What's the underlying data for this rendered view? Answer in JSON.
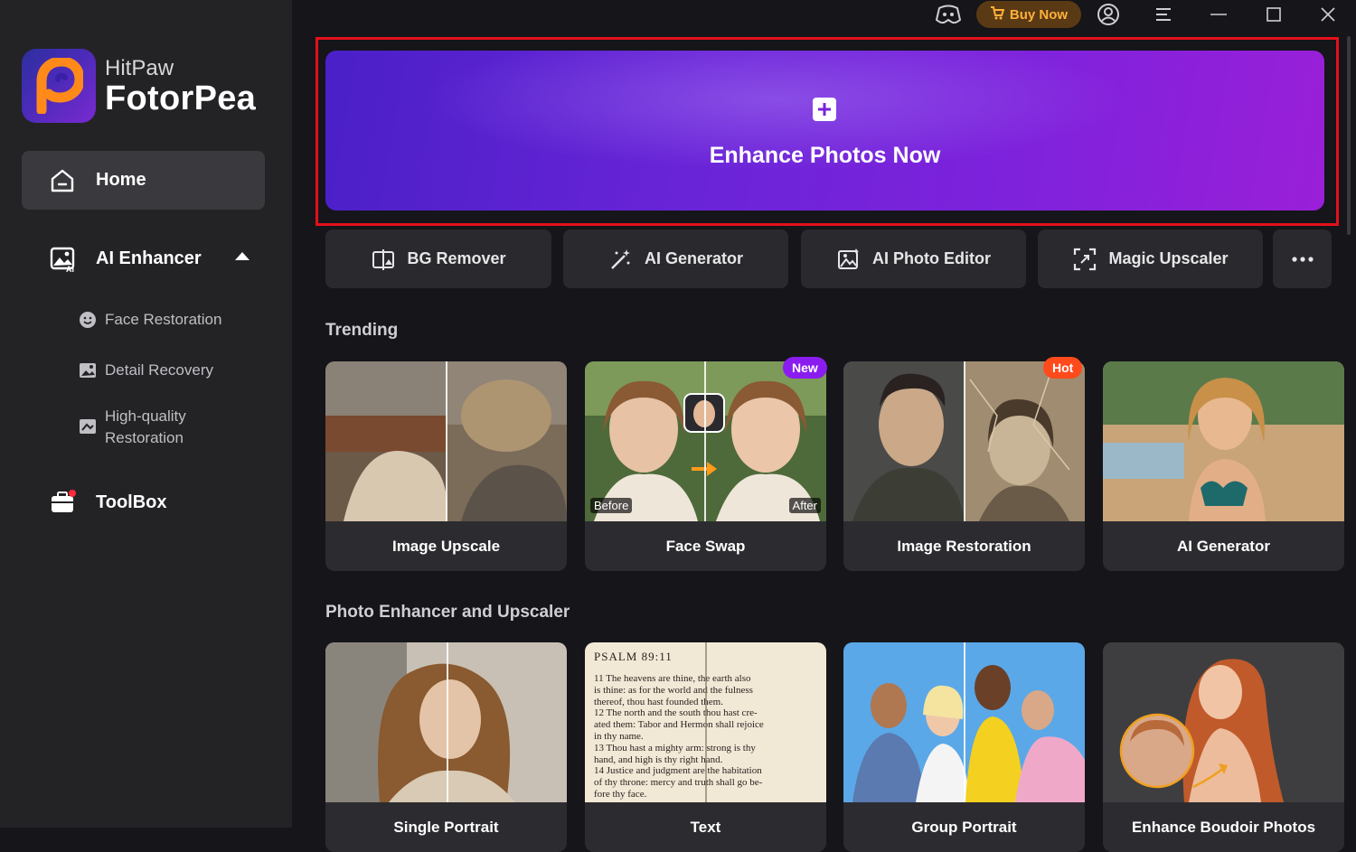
{
  "app": {
    "brand_small": "HitPaw",
    "brand_big": "FotorPea"
  },
  "sidebar": {
    "home": "Home",
    "ai_enhancer": "AI Enhancer",
    "sub_items": [
      "Face Restoration",
      "Detail Recovery",
      "High-quality",
      "Restoration"
    ],
    "toolbox": "ToolBox"
  },
  "titlebar": {
    "buy_now": "Buy Now"
  },
  "banner": {
    "text": "Enhance Photos Now"
  },
  "tools": [
    "BG Remover",
    "AI Generator",
    "AI Photo Editor",
    "Magic Upscaler"
  ],
  "sections": {
    "trending": "Trending",
    "enhancer": "Photo Enhancer and Upscaler"
  },
  "trending_cards": [
    {
      "label": "Image Upscale"
    },
    {
      "label": "Face Swap",
      "badge": "New",
      "before": "Before",
      "after": "After"
    },
    {
      "label": "Image Restoration",
      "badge": "Hot"
    },
    {
      "label": "AI Generator"
    }
  ],
  "enhancer_cards": [
    {
      "label": "Single Portrait"
    },
    {
      "label": "Text",
      "heading": "PSALM 89:11",
      "lines": [
        "11  The heavens are thine, the earth also",
        "is thine: as for the world and the fulness",
        "thereof, thou hast founded them.",
        "12  The north and the south thou hast cre-",
        "ated them: Tabor and Hermon shall rejoice",
        "in thy name.",
        "13  Thou hast a mighty arm: strong is thy",
        "hand, and high is thy right hand.",
        "14  Justice and judgment are the habitation",
        "of thy throne: mercy and truth shall go be-",
        "fore thy face."
      ]
    },
    {
      "label": "Group Portrait"
    },
    {
      "label": "Enhance Boudoir Photos"
    }
  ],
  "colors": {
    "accent_purple": "#7a22dc",
    "highlight_red": "#e3101b",
    "buy_orange": "#ffb13b",
    "badge_new": "#8a1cf0",
    "badge_hot": "#ff4a1c"
  }
}
